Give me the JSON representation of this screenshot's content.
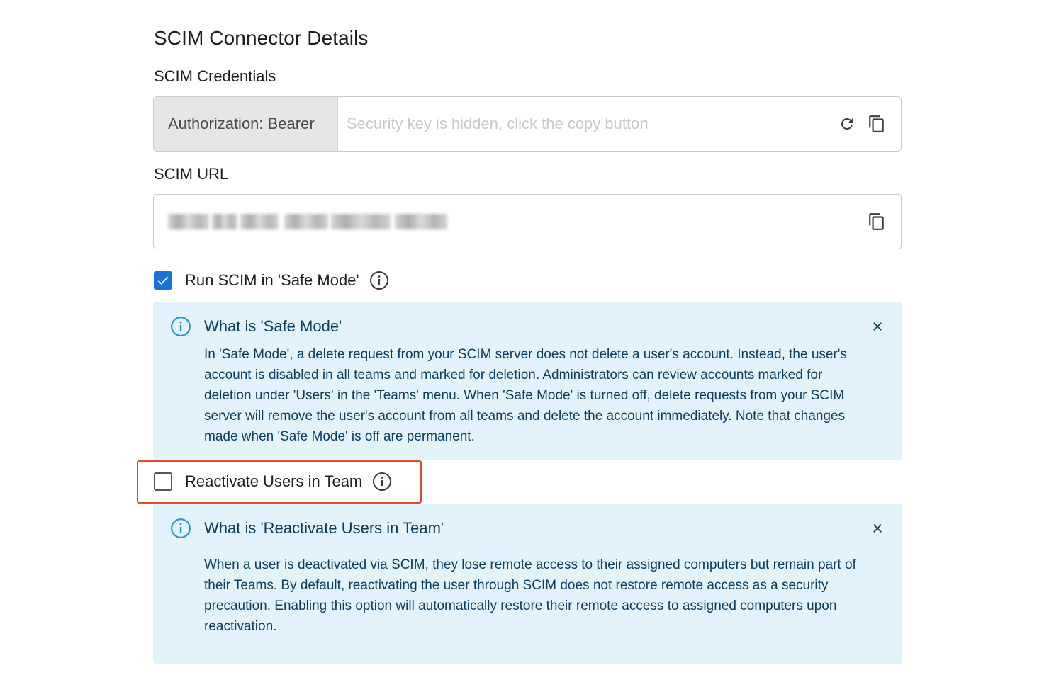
{
  "page": {
    "title": "SCIM Connector Details"
  },
  "credentials": {
    "label": "SCIM Credentials",
    "prefix": "Authorization: Bearer",
    "placeholder": "Security key is hidden, click the copy button",
    "value": "",
    "icons": [
      "refresh-icon",
      "copy-icon"
    ]
  },
  "url": {
    "label": "SCIM URL",
    "value_state": "blurred",
    "icons": [
      "copy-icon"
    ]
  },
  "safe_mode": {
    "label": "Run SCIM in 'Safe Mode'",
    "checked": true,
    "alert": {
      "title": "What is 'Safe Mode'",
      "body": "In 'Safe Mode', a delete request from your SCIM server does not delete a user's account. Instead, the user's account is disabled in all teams and marked for deletion. Administrators can review accounts marked for deletion under 'Users' in the 'Teams' menu. When 'Safe Mode' is turned off, delete requests from your SCIM server will remove the user's account from all teams and delete the account immediately. Note that changes made when 'Safe Mode' is off are permanent."
    }
  },
  "reactivate": {
    "label": "Reactivate Users in Team",
    "checked": false,
    "highlighted": true,
    "alert": {
      "title": "What is 'Reactivate Users in Team'",
      "body": "When a user is deactivated via SCIM, they lose remote access to their assigned computers but remain part of their Teams. By default, reactivating the user through SCIM does not restore remote access as a security precaution. Enabling this option will automatically restore their remote access to assigned computers upon reactivation."
    }
  },
  "colors": {
    "accent": "#1a73d9",
    "alert_bg": "#e3f3fb",
    "alert_text": "#0d3c61",
    "highlight": "#e04a2f"
  }
}
